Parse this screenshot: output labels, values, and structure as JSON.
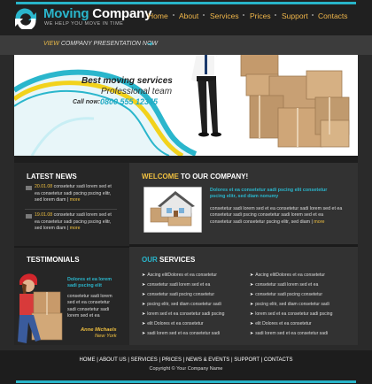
{
  "logo": {
    "word1": "Moving",
    "word2": "Company",
    "tagline": "WE HELP YOU MOVE IN TIME"
  },
  "nav": [
    {
      "label": "Home"
    },
    {
      "label": "About"
    },
    {
      "label": "Services"
    },
    {
      "label": "Prices"
    },
    {
      "label": "Support"
    },
    {
      "label": "Contacts"
    }
  ],
  "presentation": {
    "view": "VIEW",
    "rest": "COMPANY PRESENTATION NOW"
  },
  "hero": {
    "title": "Best moving services",
    "subtitle": "Professional team",
    "call_label": "Call now:",
    "phone": "0800 555 12345"
  },
  "latest_news": {
    "heading": "LATEST NEWS",
    "items": [
      {
        "date": "20.01.08",
        "text": " consetetur sadi lorem sed et ea consetetur sadi pscing pscing elitr, sed lorem diam",
        "more": "more"
      },
      {
        "date": "19.01.08",
        "text": " consetetur sadi lorem sed et ea consetetur sadi pscing pscing elitr, sed lorem diam",
        "more": "more"
      }
    ]
  },
  "testimonials": {
    "heading": "TESTIMONIALS",
    "lead": "Dolores et ea lorem sadi pscing elit",
    "body": "consetetur sadi lorem sed et ea consetetur sadi consetetur sadi lorem sed et ea",
    "name": "Anne Michaels",
    "city": "New York"
  },
  "welcome": {
    "heading_a": "WELCOME",
    "heading_b": " TO OUR COMPANY!",
    "lead": "Dolores et ea consetetur sadi pscing elit consetetur pscing elitr, sed diam nonumy",
    "body": "consetetur sadi lorem sed et ea consetetur sadi lorem sed et ea consetetur sadi pscing consetetur sadi lorem sed et ea consetetur sadi consetetur pscing elitr, sed diam",
    "more": "more"
  },
  "services": {
    "heading_a": "OUR",
    "heading_b": " SERVICES",
    "left": [
      "Ascing elitDolores et ea consetetur",
      "consetetur sadi lorem sed et ea",
      "consetetur sadi pscing consetetur",
      "pscing elitr, sed diam consetetur sadi",
      "lorem sed et ea consetetur sadi pscing",
      "elit Dolores et ea consetetur",
      "sadi lorem sed et ea consetetur sadi"
    ],
    "right": [
      "Ascing elitDolores et ea consetetur",
      "consetetur sadi lorem sed et ea",
      "consetetur sadi pscing consetetur",
      "pscing elitr, sed diam consetetur sadi",
      "lorem sed et ea consetetur sadi pscing",
      "elit Dolores et ea consetetur",
      "sadi lorem sed et ea consetetur sadi"
    ]
  },
  "footer": {
    "links": [
      "HOME",
      "ABOUT US",
      "SERVICES",
      "PRICES",
      "NEWS & EVENTS",
      "SUPPORT",
      "CONTACTS"
    ],
    "copyright": "Copyright © Your Company Name"
  },
  "colors": {
    "accent": "#2ab6cc",
    "highlight": "#f0c040",
    "nav": "#f0b64a",
    "background": "#2a2a2a"
  }
}
